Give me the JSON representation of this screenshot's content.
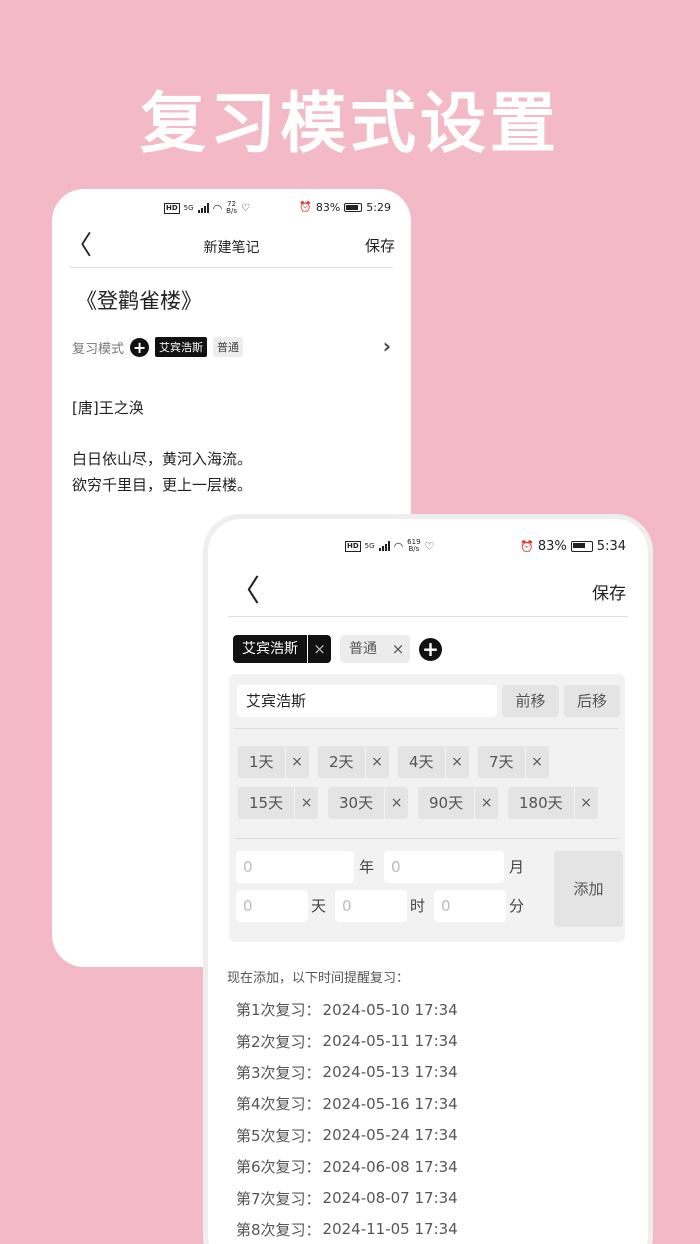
{
  "headline": "复习模式设置",
  "phone1": {
    "status": {
      "net_speed": "72",
      "net_unit": "B/s",
      "battery": "83%",
      "time": "5:29",
      "hd": "HD",
      "sig": "5G"
    },
    "nav": {
      "title": "新建笔记",
      "save": "保存"
    },
    "note_title": "《登鹳雀楼》",
    "review_mode": {
      "label": "复习模式",
      "tags": [
        "艾宾浩斯",
        "普通"
      ]
    },
    "author": "[唐]王之涣",
    "lines": [
      "白日依山尽，黄河入海流。",
      "欲穷千里目，更上一层楼。"
    ]
  },
  "phone2": {
    "status": {
      "net_speed": "619",
      "net_unit": "B/s",
      "battery": "83%",
      "time": "5:34",
      "hd": "HD",
      "sig": "5G"
    },
    "nav": {
      "save": "保存"
    },
    "tags": [
      {
        "label": "艾宾浩斯",
        "close": "×"
      },
      {
        "label": "普通",
        "close": "×"
      }
    ],
    "plan_name": "艾宾浩斯",
    "move_up": "前移",
    "move_down": "后移",
    "intervals": [
      "1天",
      "2天",
      "4天",
      "7天",
      "15天",
      "30天",
      "90天",
      "180天"
    ],
    "interval_close": "×",
    "input_fields": [
      {
        "placeholder": "0",
        "unit": "年"
      },
      {
        "placeholder": "0",
        "unit": "月"
      },
      {
        "placeholder": "0",
        "unit": "天"
      },
      {
        "placeholder": "0",
        "unit": "时"
      },
      {
        "placeholder": "0",
        "unit": "分"
      }
    ],
    "add_label": "添加",
    "schedule_title": "现在添加，以下时间提醒复习：",
    "schedule": [
      {
        "label": "第1次复习：",
        "time": "2024-05-10 17:34"
      },
      {
        "label": "第2次复习：",
        "time": "2024-05-11 17:34"
      },
      {
        "label": "第3次复习：",
        "time": "2024-05-13 17:34"
      },
      {
        "label": "第4次复习：",
        "time": "2024-05-16 17:34"
      },
      {
        "label": "第5次复习：",
        "time": "2024-05-24 17:34"
      },
      {
        "label": "第6次复习：",
        "time": "2024-06-08 17:34"
      },
      {
        "label": "第7次复习：",
        "time": "2024-08-07 17:34"
      },
      {
        "label": "第8次复习：",
        "time": "2024-11-05 17:34"
      }
    ]
  }
}
